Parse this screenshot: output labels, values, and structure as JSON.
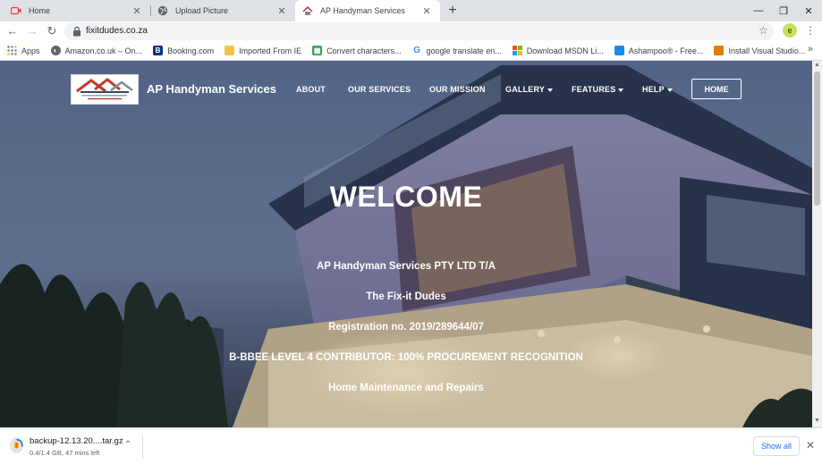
{
  "browser": {
    "tabs": [
      {
        "title": "Home",
        "icon": "video-icon",
        "active": false
      },
      {
        "title": "Upload Picture",
        "icon": "globe-icon",
        "active": false
      },
      {
        "title": "AP Handyman Services",
        "icon": "site-logo-icon",
        "active": true
      }
    ],
    "new_tab_label": "+",
    "url": "fixitdudes.co.za",
    "bookmarks": [
      {
        "label": "Apps",
        "icon": "apps-grid-icon",
        "color": "#ea4335"
      },
      {
        "label": "Amazon.co.uk – On...",
        "icon": "globe-icon",
        "color": "#5f6368"
      },
      {
        "label": "Booking.com",
        "icon": "booking-icon",
        "color": "#003580"
      },
      {
        "label": "Imported From IE",
        "icon": "folder-icon",
        "color": "#f6c342"
      },
      {
        "label": "Convert characters...",
        "icon": "grid-icon",
        "color": "#34a853"
      },
      {
        "label": "google translate en...",
        "icon": "google-icon",
        "color": "#4285f4"
      },
      {
        "label": "Download MSDN Li...",
        "icon": "windows-icon",
        "color": "#00a4ef"
      },
      {
        "label": "Ashampoo® - Free...",
        "icon": "ashampoo-icon",
        "color": "#1e88e5"
      },
      {
        "label": "Install Visual Studio...",
        "icon": "vs-icon",
        "color": "#e57c00"
      }
    ],
    "more_bookmarks": "»"
  },
  "site": {
    "brand": "AP Handyman Services",
    "nav": [
      {
        "label": "ABOUT",
        "dropdown": false
      },
      {
        "label": "OUR SERVICES",
        "dropdown": false
      },
      {
        "label": "OUR MISSION",
        "dropdown": false
      },
      {
        "label": "GALLERY",
        "dropdown": true
      },
      {
        "label": "FEATURES",
        "dropdown": true
      },
      {
        "label": "HELP",
        "dropdown": true
      }
    ],
    "home_button": "HOME",
    "hero": {
      "heading": "WELCOME",
      "lines": [
        "AP Handyman Services PTY LTD T/A",
        "The Fix-it Dudes",
        "Registration no. 2019/289644/07",
        "B-BBEE LEVEL 4 CONTRIBUTOR: 100% PROCUREMENT RECOGNITION",
        "Home Maintenance and Repairs"
      ]
    }
  },
  "download_shelf": {
    "filename": "backup-12.13.20....tar.gz",
    "status": "0.4/1.4 GB, 47 mins left",
    "progress": 0.29,
    "show_all": "Show all"
  }
}
